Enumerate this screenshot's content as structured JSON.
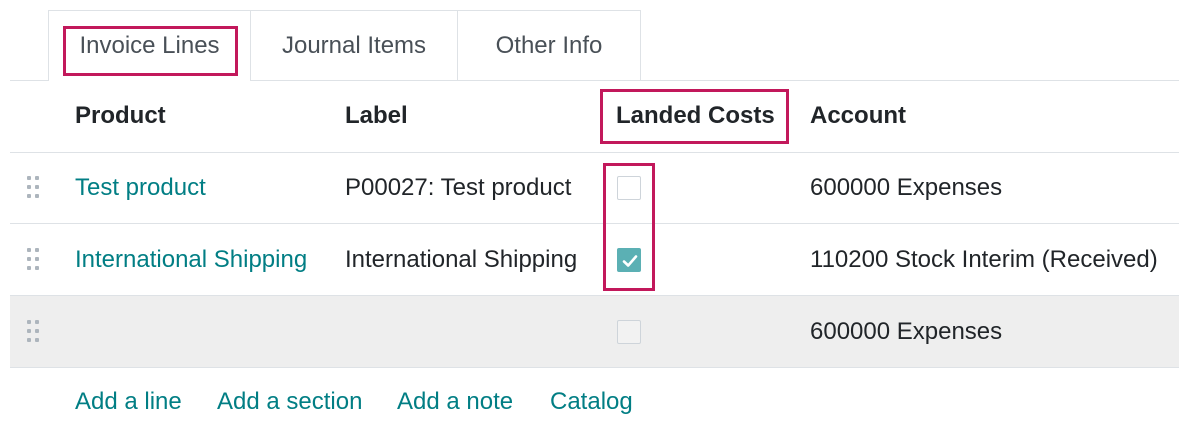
{
  "tabs": [
    {
      "label": "Invoice Lines",
      "active": true
    },
    {
      "label": "Journal Items",
      "active": false
    },
    {
      "label": "Other Info",
      "active": false
    }
  ],
  "columns": {
    "product": "Product",
    "label": "Label",
    "landed_costs": "Landed Costs",
    "account": "Account"
  },
  "rows": [
    {
      "product": "Test product",
      "label": "P00027: Test product",
      "landed_costs": false,
      "account": "600000 Expenses"
    },
    {
      "product": "International Shipping",
      "label": "International Shipping",
      "landed_costs": true,
      "account": "110200 Stock Interim (Received)"
    },
    {
      "product": "",
      "label": "",
      "landed_costs": false,
      "account": "600000 Expenses"
    }
  ],
  "actions": {
    "add_line": "Add a line",
    "add_section": "Add a section",
    "add_note": "Add a note",
    "catalog": "Catalog"
  },
  "colors": {
    "link": "#017e84",
    "checkbox_checked": "#5bb0b4",
    "highlight": "#c2185b"
  }
}
